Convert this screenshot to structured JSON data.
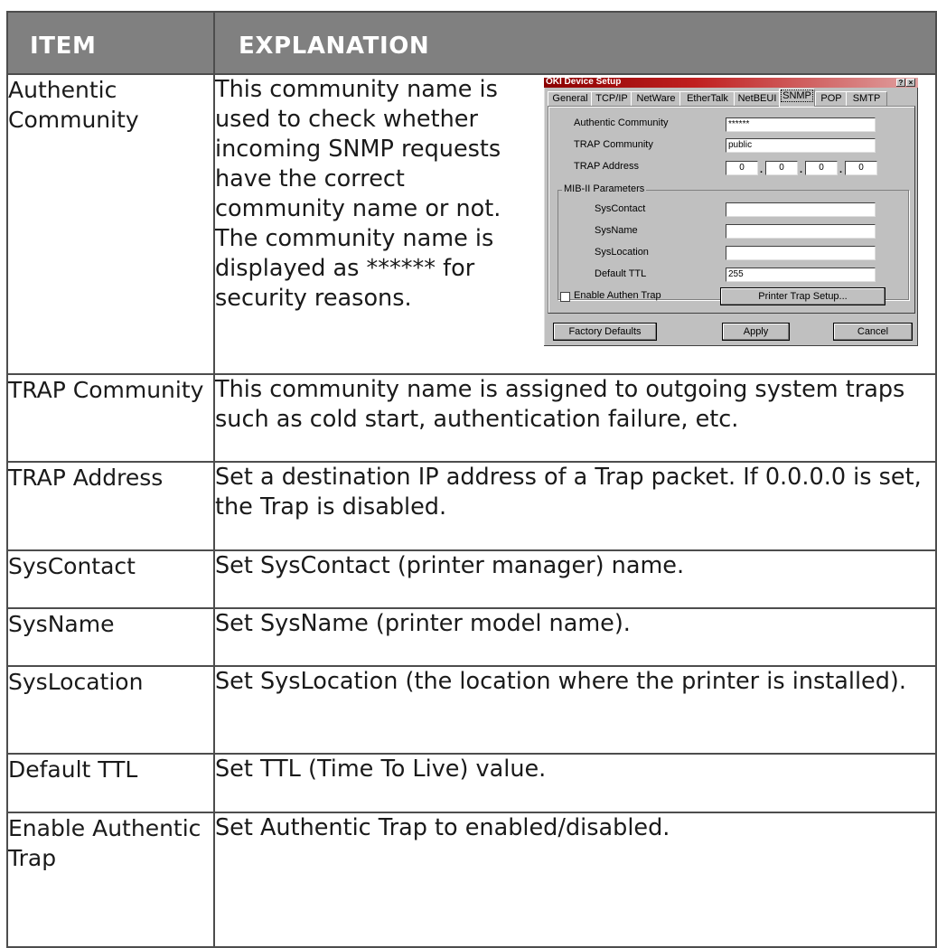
{
  "table": {
    "header": {
      "item": "ITEM",
      "explanation": "EXPLANATION"
    },
    "rows": [
      {
        "item": "Authentic Community",
        "explanation": "This community name is used to check whether incoming SNMP requests have the correct community name or not. The community name is displayed as ****** for security reasons."
      },
      {
        "item": "TRAP Community",
        "explanation": "This community name is assigned to outgoing system traps such as cold start, authentication failure, etc."
      },
      {
        "item": "TRAP Address",
        "explanation": "Set a destination IP address of a Trap packet. If 0.0.0.0 is set, the Trap is disabled."
      },
      {
        "item": "SysContact",
        "explanation": "Set SysContact (printer manager) name."
      },
      {
        "item": "SysName",
        "explanation": "Set SysName (printer model name)."
      },
      {
        "item": "SysLocation",
        "explanation": "Set SysLocation (the location where the printer is installed)."
      },
      {
        "item": "Default TTL",
        "explanation": "Set TTL (Time To Live) value."
      },
      {
        "item": "Enable Authentic Trap",
        "explanation": "Set Authentic Trap to enabled/disabled."
      }
    ]
  },
  "dialog": {
    "title": "OKI Device Setup",
    "title_buttons": [
      "?",
      "×"
    ],
    "tabs": [
      "General",
      "TCP/IP",
      "NetWare",
      "EtherTalk",
      "NetBEUI",
      "SNMP",
      "POP",
      "SMTP"
    ],
    "active_tab": "SNMP",
    "fields": {
      "authentic_community_label": "Authentic Community",
      "authentic_community_value": "******",
      "trap_community_label": "TRAP Community",
      "trap_community_value": "public",
      "trap_address_label": "TRAP Address",
      "trap_address_octets": [
        "0",
        "0",
        "0",
        "0"
      ]
    },
    "mib": {
      "group_title": "MIB-II Parameters",
      "syscontact_label": "SysContact",
      "syscontact_value": "",
      "sysname_label": "SysName",
      "sysname_value": "",
      "syslocation_label": "SysLocation",
      "syslocation_value": "",
      "default_ttl_label": "Default TTL",
      "default_ttl_value": "255"
    },
    "enable_authen_trap_label": "Enable Authen Trap",
    "enable_authen_trap_checked": false,
    "printer_trap_setup_label": "Printer Trap Setup...",
    "buttons": {
      "factory_defaults": "Factory Defaults",
      "apply": "Apply",
      "cancel": "Cancel"
    }
  },
  "colors": {
    "header_bg": "#808080",
    "header_text": "#ffffff",
    "border": "#4d4d4d",
    "dialog_face": "#c0c0c0",
    "titlebar": "#8b0000"
  }
}
